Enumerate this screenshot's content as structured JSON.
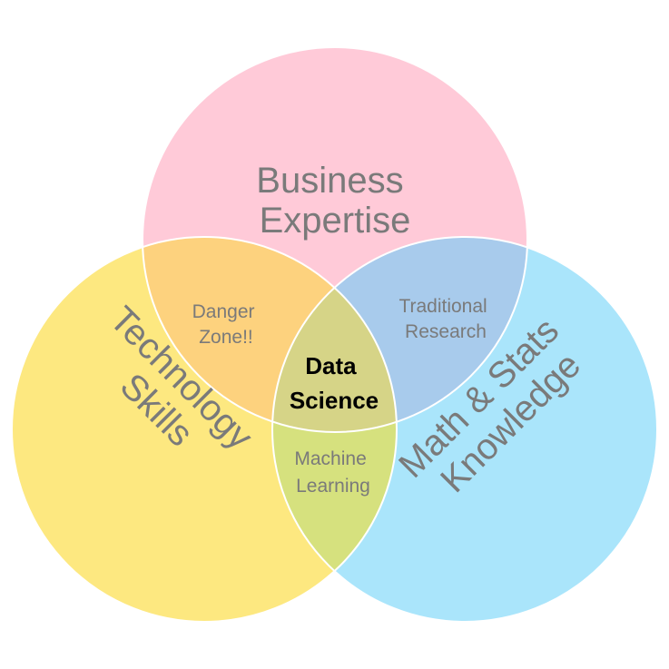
{
  "colors": {
    "business": "#ffcad8",
    "technology": "#fde880",
    "math": "#aae5fb",
    "business_technology": "#fdd27e",
    "business_math": "#a8cbec",
    "technology_math": "#d6e17e",
    "center": "#d6d487",
    "outline": "#ffffff",
    "label": "#7a7a7a",
    "center_label": "#000000"
  },
  "circles": {
    "business": {
      "label_lines": [
        "Business",
        "Expertise"
      ]
    },
    "technology": {
      "label_lines": [
        "Technology",
        "Skills"
      ]
    },
    "math": {
      "label_lines": [
        "Math & Stats",
        "Knowledge"
      ]
    }
  },
  "overlaps": {
    "business_technology": {
      "label_lines": [
        "Danger",
        "Zone!!"
      ]
    },
    "business_math": {
      "label_lines": [
        "Traditional",
        "Research"
      ]
    },
    "technology_math": {
      "label_lines": [
        "Machine",
        "Learning"
      ]
    },
    "center": {
      "label_lines": [
        "Data",
        "Science"
      ]
    }
  }
}
